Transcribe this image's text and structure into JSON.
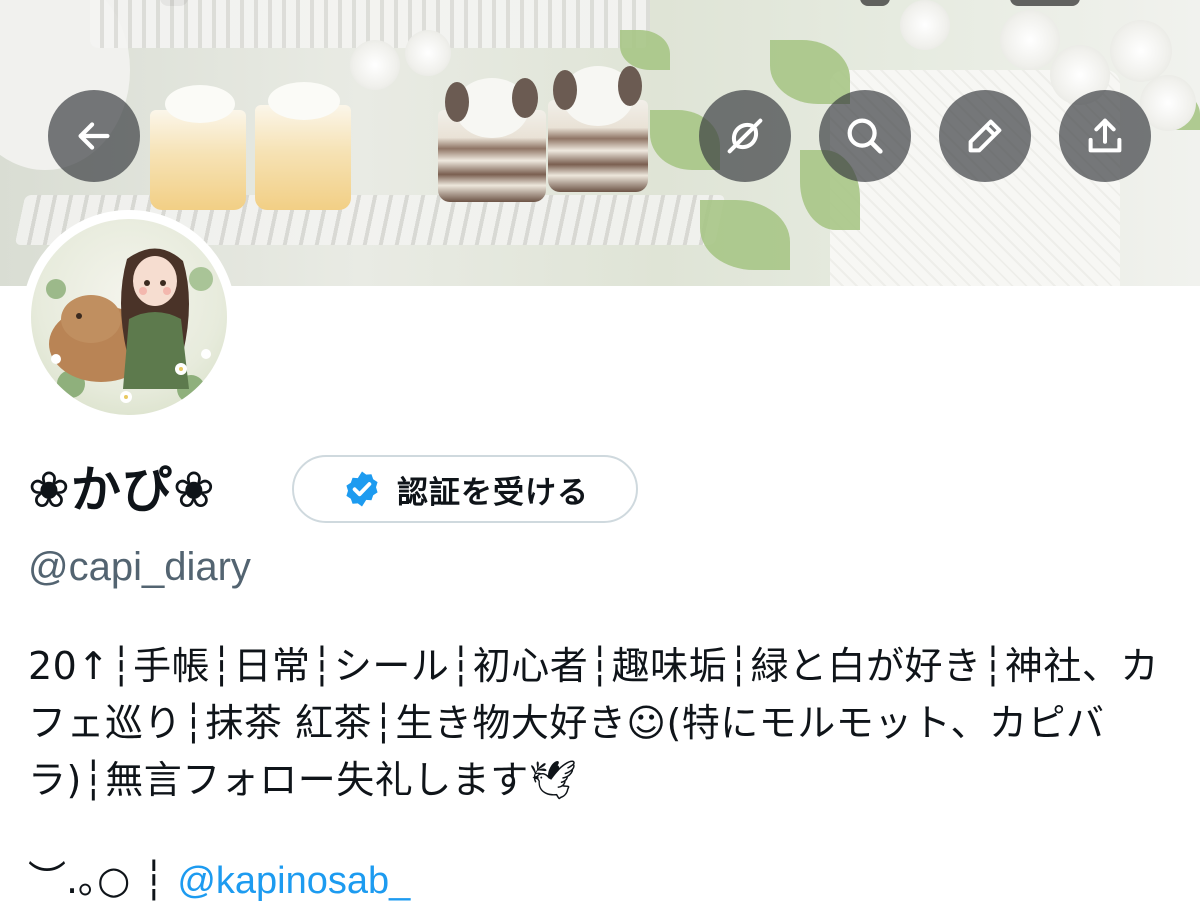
{
  "header": {
    "back_icon": "arrow-left-icon",
    "actions": [
      {
        "name": "grok-icon"
      },
      {
        "name": "search-icon"
      },
      {
        "name": "edit-pencil-icon"
      },
      {
        "name": "share-upload-icon"
      }
    ]
  },
  "profile": {
    "display_name": "❀かぴ❀",
    "verify_button_label": "認証を受ける",
    "handle": "@capi_diary",
    "bio": "20↑┆手帳┆日常┆シール┆初心者┆趣味垢┆緑と白が好き┆神社、カフェ巡り┆抹茶 紅茶┆生き物大好き☺(特にモルモット、カピバラ)┆無言フォロー失礼します🕊",
    "bio_ornament": "︶.｡○",
    "bio_separator": "┆",
    "bio_mention": "@kapinosab_"
  },
  "colors": {
    "link": "#1d9bf0",
    "verified_badge": "#1d9bf0",
    "secondary_text": "#536471",
    "overlay_button": "#373a3e"
  }
}
